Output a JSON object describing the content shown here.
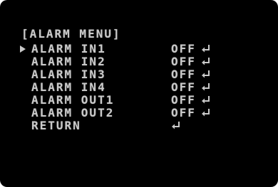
{
  "menu": {
    "title": "[ALARM MENU]",
    "selected_index": 0,
    "items": [
      {
        "label": "ALARM IN1",
        "value": "OFF"
      },
      {
        "label": "ALARM IN2",
        "value": "OFF"
      },
      {
        "label": "ALARM IN3",
        "value": "OFF"
      },
      {
        "label": "ALARM IN4",
        "value": "OFF"
      },
      {
        "label": "ALARM OUT1",
        "value": "OFF"
      },
      {
        "label": "ALARM OUT2",
        "value": "OFF"
      },
      {
        "label": "RETURN",
        "value": ""
      }
    ],
    "enter_icon": "enter-return-icon",
    "colors": {
      "background": "#000000",
      "text": "#c9c9c9"
    }
  }
}
